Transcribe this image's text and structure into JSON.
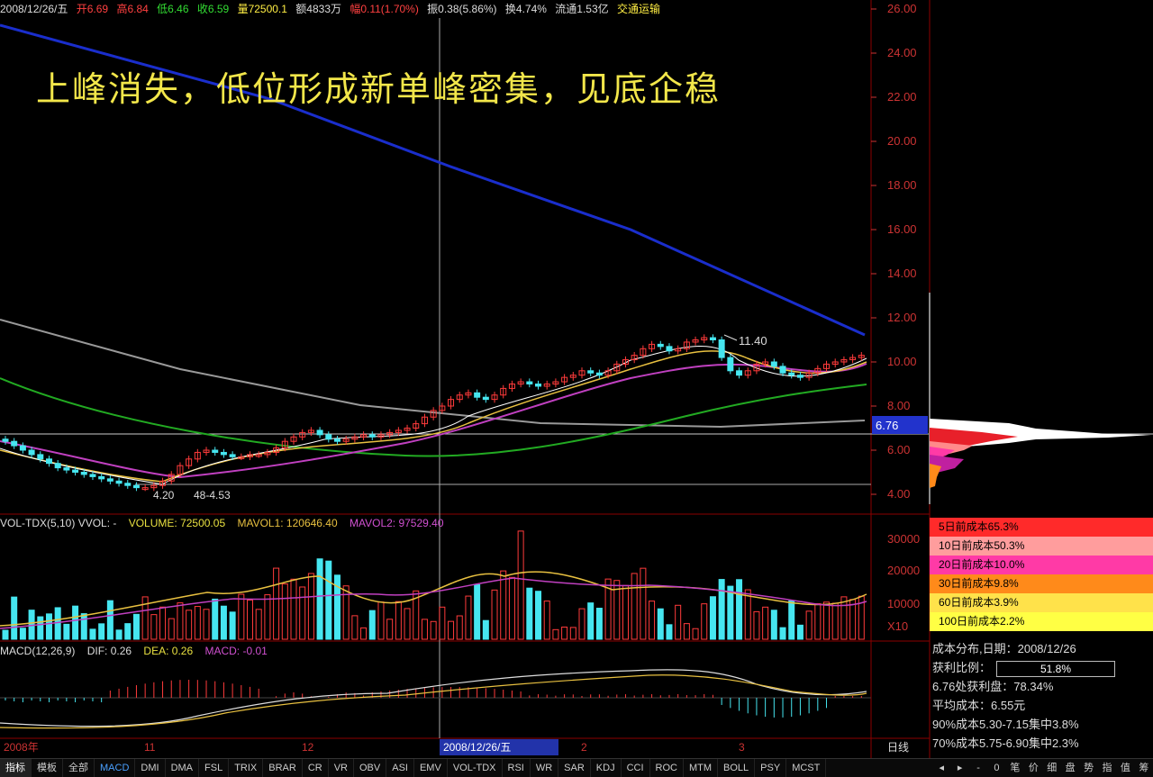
{
  "header": {
    "date": "2008/12/26/五",
    "open": "开6.69",
    "high": "高6.84",
    "low": "低6.46",
    "close": "收6.59",
    "volume": "量72500.1",
    "amount": "额4833万",
    "change": "幅0.11(1.70%)",
    "amplitude": "振0.38(5.86%)",
    "turnover": "换4.74%",
    "float": "流通1.53亿",
    "industry": "交通运输"
  },
  "headline": "上峰消失，低位形成新单峰密集，见底企稳",
  "colors": {
    "up": "#ff3b3b",
    "down": "#46e6f0",
    "headline": "#f2e64a",
    "grid": "#8b0000"
  },
  "price_axis": [
    "26.00",
    "24.00",
    "22.00",
    "20.00",
    "18.00",
    "16.00",
    "14.00",
    "12.00",
    "10.00",
    "8.00",
    "6.00",
    "4.00"
  ],
  "current_price_tag": "6.76",
  "high_marker": "11.40",
  "low_marker": "4.20",
  "low_marker_extra": "48-4.53",
  "volume_label": {
    "name": "VOL-TDX(5,10) VVOL: -",
    "volume": "VOLUME: 72500.05",
    "mavol1": "MAVOL1: 120646.40",
    "mavol2": "MAVOL2: 97529.40"
  },
  "volume_axis": [
    "30000",
    "20000",
    "10000",
    "X10"
  ],
  "macd_label": {
    "name": "MACD(12,26,9)",
    "dif": "DIF: 0.26",
    "dea": "DEA: 0.26",
    "macd": "MACD: -0.01"
  },
  "date_axis": {
    "left": "2008年",
    "m11": "11",
    "m12": "12",
    "cursor": "2008/12/26/五",
    "m2": "2",
    "m3": "3",
    "right": "日线"
  },
  "cost_panel": [
    {
      "label": "5日前成本65.3%",
      "color": "#ff2a2a"
    },
    {
      "label": "10日前成本50.3%",
      "color": "#ff9d9d"
    },
    {
      "label": "20日前成本10.0%",
      "color": "#ff3aa6"
    },
    {
      "label": "30日前成本9.8%",
      "color": "#ff8a1a"
    },
    {
      "label": "60日前成本3.9%",
      "color": "#ffe24a"
    },
    {
      "label": "100日前成本2.2%",
      "color": "#ffff44"
    }
  ],
  "stats": {
    "title": "成本分布,日期：2008/12/26",
    "ratio_label": "获利比例：",
    "ratio_value": "51.8%",
    "profit": "6.76处获利盘：78.34%",
    "avg_cost": "平均成本：6.55元",
    "c90": "90%成本5.30-7.15集中3.8%",
    "c70": "70%成本5.75-6.90集中2.3%"
  },
  "tabs": [
    "指标",
    "模板",
    "全部",
    "MACD",
    "DMI",
    "DMA",
    "FSL",
    "TRIX",
    "BRAR",
    "CR",
    "VR",
    "OBV",
    "ASI",
    "EMV",
    "VOL-TDX",
    "RSI",
    "WR",
    "SAR",
    "KDJ",
    "CCI",
    "ROC",
    "MTM",
    "BOLL",
    "PSY",
    "MCST"
  ],
  "right_tabs": [
    "◂",
    "▸",
    "-",
    "0",
    "笔",
    "价",
    "细",
    "盘",
    "势",
    "指",
    "值",
    "筹"
  ]
}
